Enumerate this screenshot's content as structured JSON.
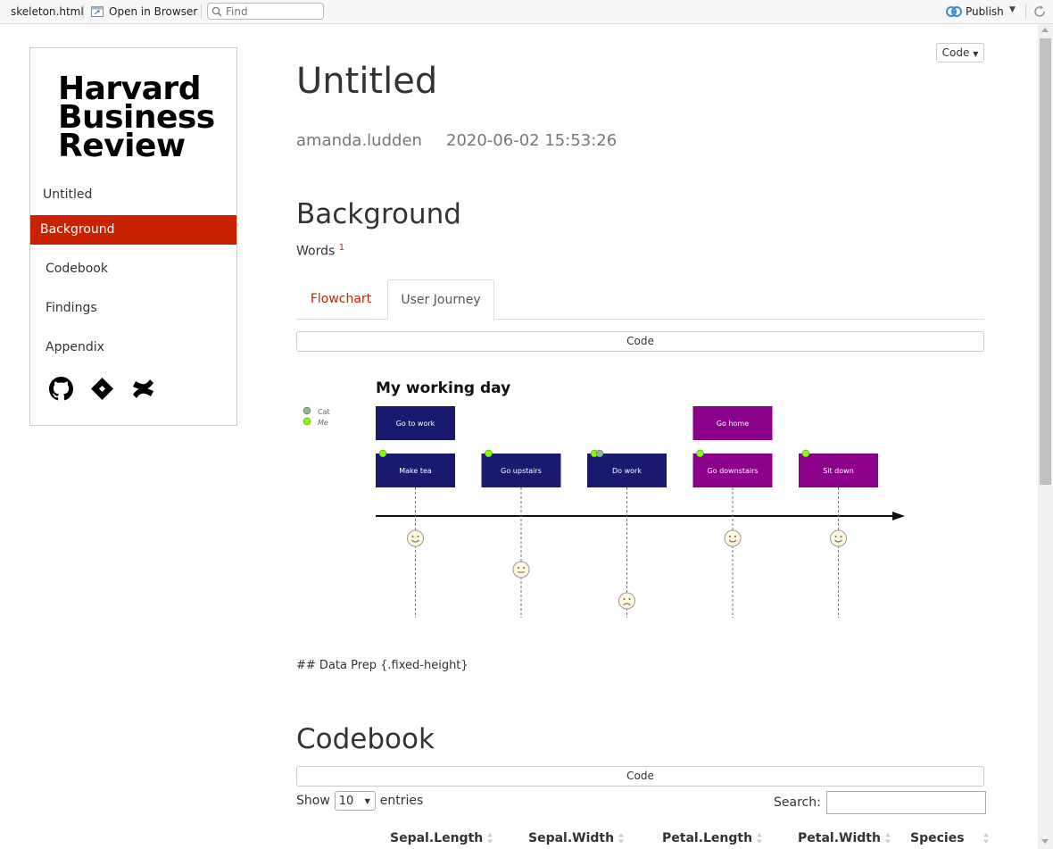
{
  "toolbar": {
    "file_name": "skeleton.html",
    "open_in_browser": "Open in Browser",
    "find_placeholder": "Find",
    "publish": "Publish"
  },
  "toc": {
    "logo_lines": [
      "Harvard",
      "Business",
      "Review"
    ],
    "top_item": "Untitled",
    "active_item": "Background",
    "items": [
      "Codebook",
      "Findings",
      "Appendix"
    ],
    "icons": [
      "github-icon",
      "git-icon",
      "confluence-icon"
    ]
  },
  "header": {
    "code_toggle": "Code",
    "title": "Untitled",
    "author": "amanda.ludden",
    "date": "2020-06-02 15:53:26"
  },
  "background": {
    "heading": "Background",
    "words": "Words",
    "footnote_ref": "1",
    "tabs": [
      "Flowchart",
      "User Journey"
    ],
    "code_button": "Code"
  },
  "journey": {
    "title": "My working day",
    "legend": [
      {
        "name": "Cat",
        "color": "#8fbc8f"
      },
      {
        "name": "Me",
        "color": "#7fff00"
      }
    ],
    "sections": [
      {
        "name": "Go to work",
        "color": "#191970"
      },
      {
        "name": "Go home",
        "color": "#8b008b"
      }
    ],
    "tasks": [
      {
        "name": "Make tea",
        "section": "Go to work",
        "score": 5,
        "actors": [
          "Me"
        ]
      },
      {
        "name": "Go upstairs",
        "section": "Go to work",
        "score": 3,
        "actors": [
          "Me"
        ]
      },
      {
        "name": "Do work",
        "section": "Go to work",
        "score": 1,
        "actors": [
          "Me",
          "Cat"
        ]
      },
      {
        "name": "Go downstairs",
        "section": "Go home",
        "score": 5,
        "actors": [
          "Me"
        ]
      },
      {
        "name": "Sit down",
        "section": "Go home",
        "score": 5,
        "actors": [
          "Me"
        ]
      }
    ]
  },
  "data_prep_text": "## Data Prep {.fixed-height}",
  "codebook": {
    "heading": "Codebook",
    "code_button": "Code",
    "show_label": "Show",
    "show_value": "10",
    "entries_label": "entries",
    "search_label": "Search:",
    "columns": [
      "Sepal.Length",
      "Sepal.Width",
      "Petal.Length",
      "Petal.Width",
      "Species"
    ]
  },
  "colors": {
    "accent": "#c82200",
    "section1": "#191970",
    "section2": "#8b008b"
  }
}
